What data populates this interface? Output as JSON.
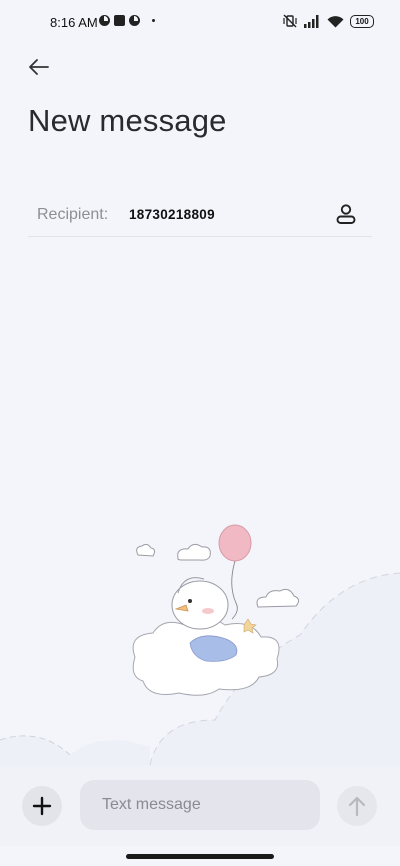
{
  "status_bar": {
    "time": "8:16 AM",
    "battery": "100",
    "icons": [
      "app-notification-icon",
      "stop-square-icon",
      "app-notification-icon",
      "dot-icon",
      "vibrate-off-icon",
      "signal-icon",
      "wifi-icon",
      "battery-icon"
    ]
  },
  "header": {
    "back_icon": "arrow-left-icon",
    "title": "New message"
  },
  "recipient": {
    "label": "Recipient:",
    "value": "18730218809",
    "contact_icon": "person-icon"
  },
  "composer": {
    "add_icon": "plus-icon",
    "placeholder": "Text message",
    "value": "",
    "send_icon": "arrow-up-icon"
  },
  "colors": {
    "background": "#f4f5fb",
    "composer_background": "#f1f2f8",
    "input_background": "#e4e5ec",
    "balloon": "#f0b9c4",
    "bird_scarf": "#a9bde9"
  }
}
